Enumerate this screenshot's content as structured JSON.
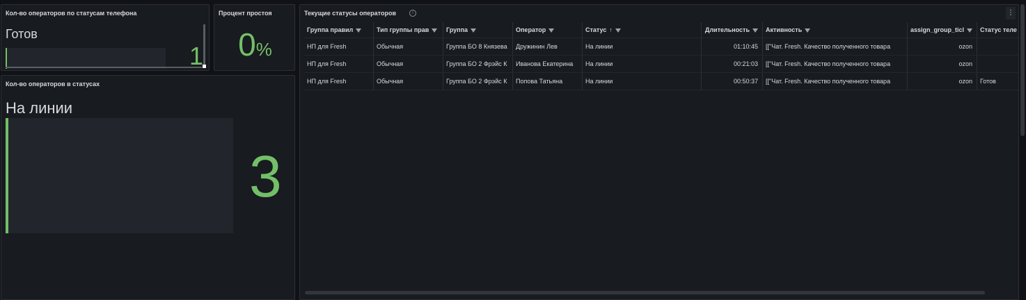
{
  "panel_phone_status": {
    "title": "Кол-во операторов по статусам телефона",
    "stat_name": "Готов",
    "stat_value": "1"
  },
  "panel_idle": {
    "title": "Процент простоя",
    "value": "0",
    "unit": "%"
  },
  "panel_status": {
    "title": "Кол-во операторов в статусах",
    "stat_name": "На линии",
    "stat_value": "3"
  },
  "panel_table": {
    "title": "Текущие статусы операторов",
    "columns": [
      "Группа правил",
      "Тип группы прав",
      "Группа",
      "Оператор",
      "Статус",
      "Длительность",
      "Активность",
      "assign_group_ticl",
      "Статус теле"
    ],
    "rows": [
      [
        "НП для Fresh",
        "Обычная",
        "Группа БО 8 Князева",
        "Дружинин Лев",
        "На линии",
        "01:10:45",
        "[[\"Чат. Fresh. Качество полученного товара",
        "ozon",
        ""
      ],
      [
        "НП для Fresh",
        "Обычная",
        "Группа БО 2 Фрэйс К",
        "Иванова Екатерина",
        "На линии",
        "00:21:03",
        "[[\"Чат. Fresh. Качество полученного товара",
        "ozon",
        ""
      ],
      [
        "НП для Fresh",
        "Обычная",
        "Группа БО 2 Фрэйс К",
        "Попова Татьяна",
        "На линии",
        "00:50:37",
        "[[\"Чат. Fresh. Качество полученного товара",
        "ozon",
        "Готов"
      ]
    ]
  },
  "colors": {
    "accent_green": "#73bf69",
    "background": "#111217",
    "panel": "#181b1f"
  }
}
